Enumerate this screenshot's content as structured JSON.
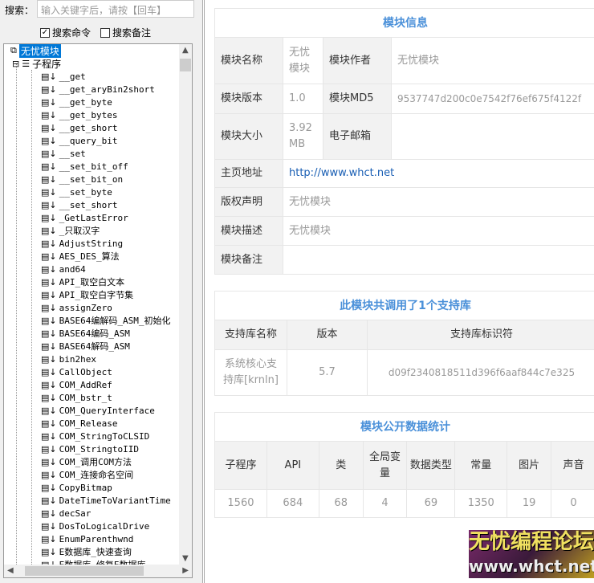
{
  "search": {
    "label": "搜索：",
    "placeholder": "输入关键字后，请按【回车】",
    "cmd_label": "搜索命令",
    "cmd_checked": true,
    "note_label": "搜索备注",
    "note_checked": false
  },
  "tree": {
    "root": "无忧模块",
    "group": "子程序",
    "items": [
      "__get",
      "__get_aryBin2short",
      "__get_byte",
      "__get_bytes",
      "__get_short",
      "__query_bit",
      "__set",
      "__set_bit_off",
      "__set_bit_on",
      "__set_byte",
      "__set_short",
      "_GetLastError",
      "_只取汉字",
      "AdjustString",
      "AES_DES_算法",
      "and64",
      "API_取空白文本",
      "API_取空白字节集",
      "assignZero",
      "BASE64编解码_ASM_初始化",
      "BASE64编码_ASM",
      "BASE64解码_ASM",
      "bin2hex",
      "CallObject",
      "COM_AddRef",
      "COM_bstr_t",
      "COM_QueryInterface",
      "COM_Release",
      "COM_StringToCLSID",
      "COM_StringtoIID",
      "COM_调用COM方法",
      "COM_连接命名空间",
      "CopyBitmap",
      "DateTimeToVariantTime",
      "decSar",
      "DosToLogicalDrive",
      "EnumParenthwnd",
      "E数据库_快速查询",
      "E数据库_修复E数据库"
    ]
  },
  "info": {
    "title": "模块信息",
    "name_label": "模块名称",
    "name": "无忧模块",
    "author_label": "模块作者",
    "author": "无忧模块",
    "version_label": "模块版本",
    "version": "1.0",
    "md5_label": "模块MD5",
    "md5": "9537747d200c0e7542f76ef675f4122f",
    "size_label": "模块大小",
    "size": "3.92 MB",
    "email_label": "电子邮箱",
    "email": "",
    "home_label": "主页地址",
    "home": "http://www.whct.net",
    "copyright_label": "版权声明",
    "copyright": "无忧模块",
    "desc_label": "模块描述",
    "desc": "无忧模块",
    "remark_label": "模块备注",
    "remark": ""
  },
  "libs": {
    "title": "此模块共调用了1个支持库",
    "headers": [
      "支持库名称",
      "版本",
      "支持库标识符"
    ],
    "rows": [
      [
        "系统核心支持库[krnln]",
        "5.7",
        "d09f2340818511d396f6aaf844c7e325"
      ]
    ]
  },
  "stats": {
    "title": "模块公开数据统计",
    "headers": [
      "子程序",
      "API",
      "类",
      "全局变量",
      "数据类型",
      "常量",
      "图片",
      "声音"
    ],
    "values": [
      "1560",
      "684",
      "68",
      "4",
      "69",
      "1350",
      "19",
      "0"
    ]
  },
  "watermark": {
    "line1": "无忧编程论坛",
    "line2": "www.whct.net"
  },
  "colors": {
    "accent": "#4a90d9",
    "selection": "#0078d7"
  }
}
